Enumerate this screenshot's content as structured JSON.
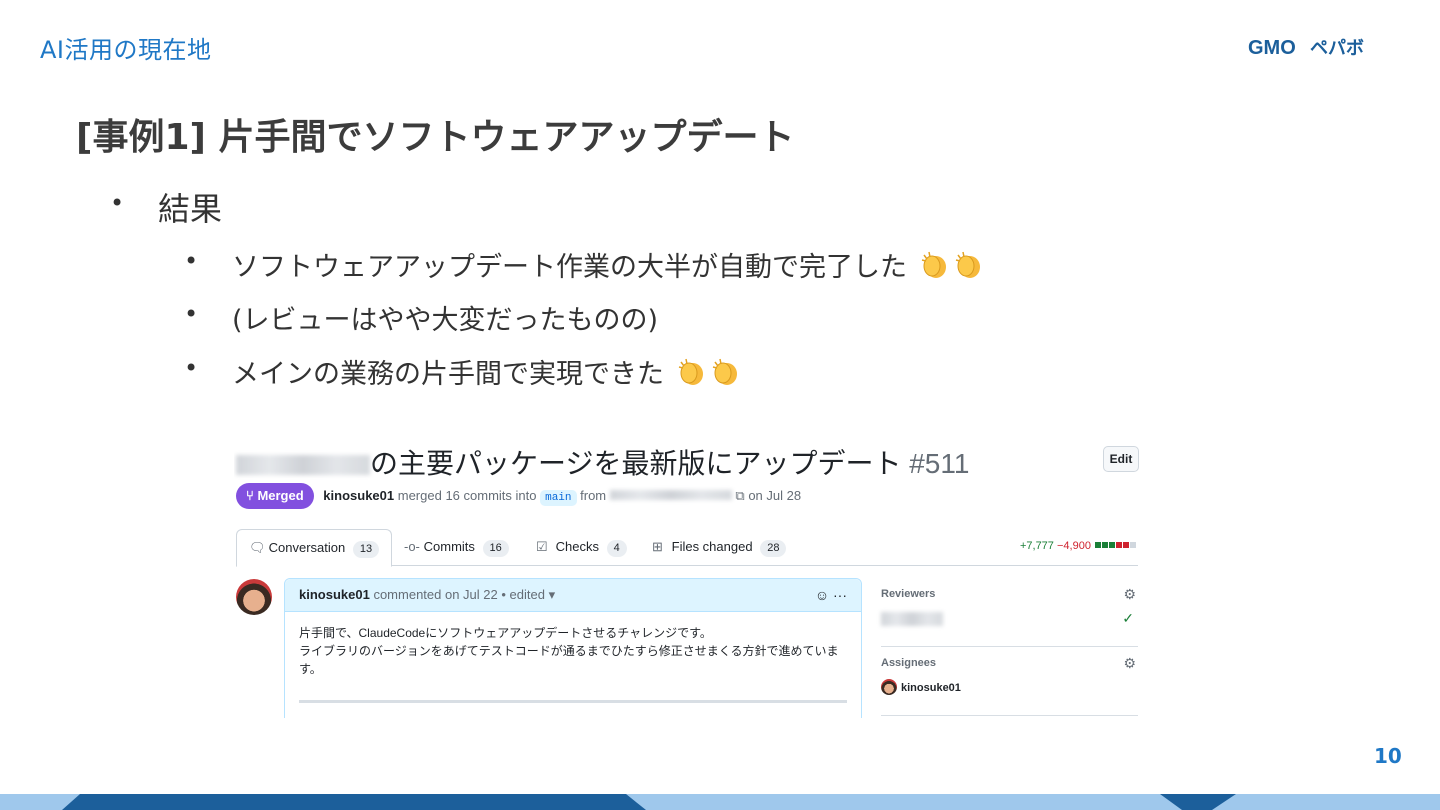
{
  "header": {
    "section_label": "AI活用の現在地",
    "logo_text": "GMOペパボ",
    "page_number": "10"
  },
  "slide": {
    "title": "[事例1] 片手間でソフトウェアアップデート",
    "bullet": "結果",
    "sub_bullets": [
      "ソフトウェアアップデート作業の大半が自動で完了した",
      "(レビューはやや大変だったものの)",
      "メインの業務の片手間で実現できた"
    ]
  },
  "github": {
    "pr_title": "の主要パッケージを最新版にアップデート",
    "pr_number": "#511",
    "edit_label": "Edit",
    "status": "Merged",
    "author": "kinosuke01",
    "merge_text": "merged 16 commits into",
    "base_branch": "main",
    "from_text": "from",
    "date_text": "on Jul 28",
    "tabs": [
      {
        "label": "Conversation",
        "count": "13",
        "icon": "comment-icon"
      },
      {
        "label": "Commits",
        "count": "16",
        "icon": "commit-icon"
      },
      {
        "label": "Checks",
        "count": "4",
        "icon": "checklist-icon"
      },
      {
        "label": "Files changed",
        "count": "28",
        "icon": "file-diff-icon"
      }
    ],
    "additions": "+7,777",
    "deletions": "−4,900",
    "comment": {
      "author": "kinosuke01",
      "meta": "commented on Jul 22 • edited",
      "line1": "片手間で、ClaudeCodeにソフトウェアアップデートさせるチャレンジです。",
      "line2": "ライブラリのバージョンをあげてテストコードが通るまでひたすら修正させまくる方針で進めていま",
      "line3": "す。"
    },
    "sidebar": {
      "reviewers_label": "Reviewers",
      "assignees_label": "Assignees",
      "assignee": "kinosuke01"
    }
  },
  "colors": {
    "accent": "#1f78c6",
    "merged": "#8250df",
    "footer_dark": "#1c5f9b",
    "footer_light": "#9fc8ec"
  }
}
